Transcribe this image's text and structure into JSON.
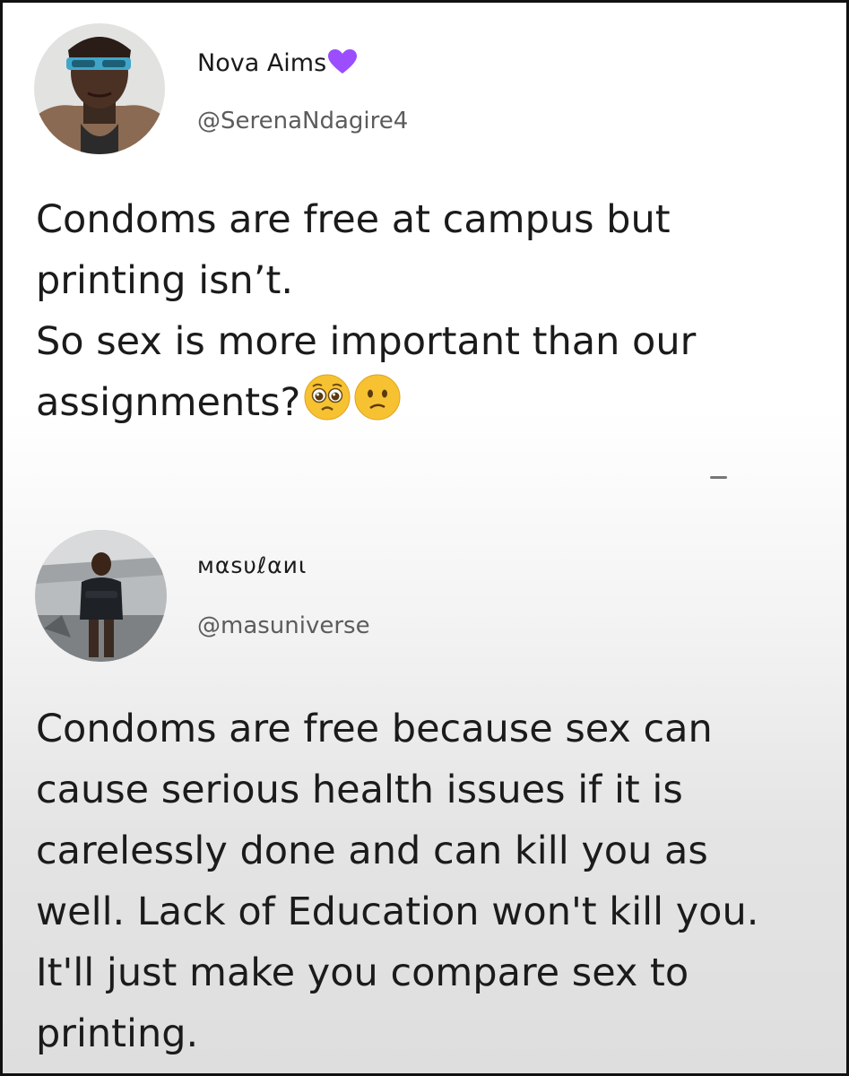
{
  "tweets": [
    {
      "display_name": "Nova Aims",
      "name_icon": "purple-heart-icon",
      "handle": "@SerenaNdagire4",
      "text": "Condoms are free at campus but\nprinting isn’t.\nSo sex is more important than our\nassignments?",
      "trailing_emojis": [
        "pleading-face-icon",
        "confused-face-icon"
      ],
      "colors": {
        "heart": "#9b4dff",
        "emoji_face": "#f7c232"
      }
    },
    {
      "display_name": "ᴍαѕυℓαиι",
      "handle": "@masuniverse",
      "text": "Condoms are free because sex can\ncause serious health issues if it is\ncarelessly done and can kill you as\nwell. Lack of Education won't kill you.\nIt'll just make you compare sex to\nprinting."
    }
  ]
}
